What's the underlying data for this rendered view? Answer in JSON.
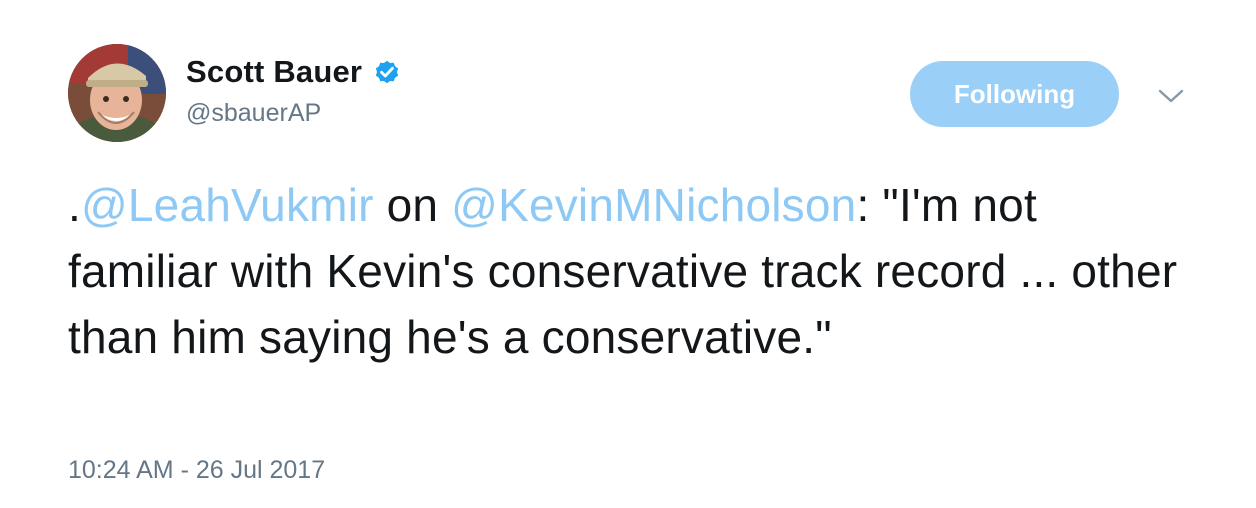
{
  "author": {
    "display_name": "Scott Bauer",
    "handle": "@sbauerAP",
    "verified": true,
    "avatar_icon": "user-avatar-photo"
  },
  "follow_button": {
    "label": "Following"
  },
  "menu": {
    "icon": "chevron-down-icon"
  },
  "tweet": {
    "prefix": ".",
    "mention_1": "@LeahVukmir",
    "connector": " on ",
    "mention_2": "@KevinMNicholson",
    "body": ": \"I'm not familiar with Kevin's conservative track record ... other than him saying he's a conservative.\"",
    "timestamp": "10:24 AM - 26 Jul 2017"
  },
  "colors": {
    "text": "#14171a",
    "secondary": "#657786",
    "link": "#8ec9f5",
    "follow_button_bg": "#9ad0f7",
    "verified_badge": "#1da1f2"
  }
}
